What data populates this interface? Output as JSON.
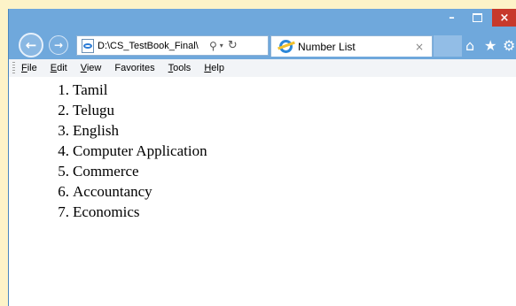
{
  "window": {
    "minimize": "–",
    "maximize": "",
    "close": "×"
  },
  "nav": {
    "back": "←",
    "forward": "→",
    "address": "D:\\CS_TestBook_Final\\",
    "search_icon": "⚲",
    "dropdown_icon": "▾",
    "refresh_icon": "↻"
  },
  "tab": {
    "title": "Number List",
    "close": "×"
  },
  "toolbar": {
    "home": "⌂",
    "favorites": "★",
    "settings": "⚙"
  },
  "menu": [
    {
      "accel": "F",
      "rest": "ile"
    },
    {
      "accel": "E",
      "rest": "dit"
    },
    {
      "accel": "V",
      "rest": "iew"
    },
    {
      "accel": "",
      "rest": "Favorites"
    },
    {
      "accel": "T",
      "rest": "ools"
    },
    {
      "accel": "H",
      "rest": "elp"
    }
  ],
  "list": [
    {
      "num": "1.",
      "text": "Tamil"
    },
    {
      "num": "2.",
      "text": "Telugu"
    },
    {
      "num": "3.",
      "text": "English"
    },
    {
      "num": "4.",
      "text": "Computer Application"
    },
    {
      "num": "5.",
      "text": "Commerce"
    },
    {
      "num": "6.",
      "text": "Accountancy"
    },
    {
      "num": "7.",
      "text": "Economics"
    }
  ],
  "colors": {
    "frame": "#6fa8dc",
    "close_button": "#c7392b",
    "page_background": "#fdf3c8"
  }
}
